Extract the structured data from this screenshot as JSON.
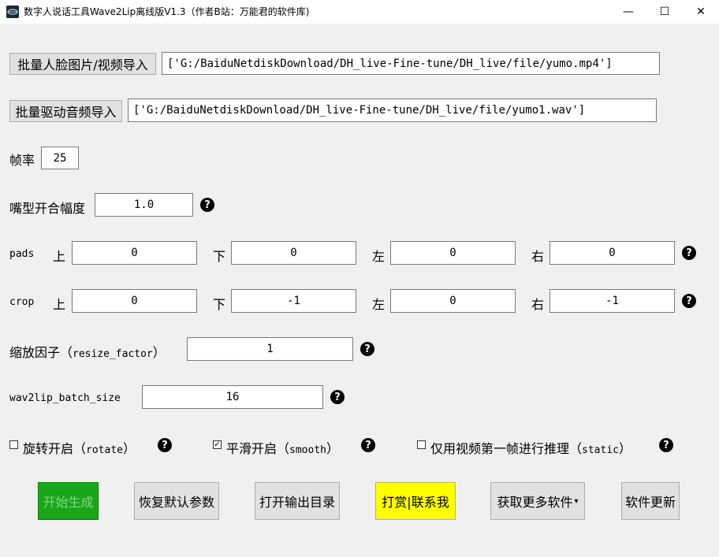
{
  "window": {
    "title": "数字人说话工具Wave2Lip离线版V1.3（作者B站：万能君的软件库)",
    "minimize": "—",
    "maximize": "☐",
    "close": "✕"
  },
  "inputs": {
    "face_button": "批量人脸图片/视频导入",
    "face_value": "['G:/BaiduNetdiskDownload/DH_live-Fine-tune/DH_live/file/yumo.mp4']",
    "audio_button": "批量驱动音频导入",
    "audio_value": "['G:/BaiduNetdiskDownload/DH_live-Fine-tune/DH_live/file/yumo1.wav']"
  },
  "fps": {
    "label": "帧率",
    "value": "25"
  },
  "mouth": {
    "label": "嘴型开合幅度",
    "value": "1.0"
  },
  "pads": {
    "label": "pads",
    "top_label": "上",
    "top": "0",
    "bottom_label": "下",
    "bottom": "0",
    "left_label": "左",
    "left": "0",
    "right_label": "右",
    "right": "0"
  },
  "crop": {
    "label": "crop",
    "top_label": "上",
    "top": "0",
    "bottom_label": "下",
    "bottom": "-1",
    "left_label": "左",
    "left": "0",
    "right_label": "右",
    "right": "-1"
  },
  "resize": {
    "label_cn": "缩放因子（",
    "label_en": "resize_factor",
    "label_end": "）",
    "value": "1"
  },
  "batch": {
    "label": "wav2lip_batch_size",
    "value": "16"
  },
  "options": {
    "rotate_cn": "旋转开启（",
    "rotate_en": "rotate",
    "rotate_end": "）",
    "smooth_cn": "平滑开启（",
    "smooth_en": "smooth",
    "smooth_end": "）",
    "static_cn": "仅用视频第一帧进行推理（",
    "static_en": "static",
    "static_end": "）"
  },
  "help_icon": "?",
  "buttons": {
    "start": "开始生成",
    "reset": "恢复默认参数",
    "open_output": "打开输出目录",
    "donate": "打赏|联系我",
    "more": "获取更多软件",
    "update": "软件更新"
  },
  "colors": {
    "start_bg": "#1aa61a",
    "start_text": "#7fd67f",
    "donate_bg": "#ffff00"
  }
}
